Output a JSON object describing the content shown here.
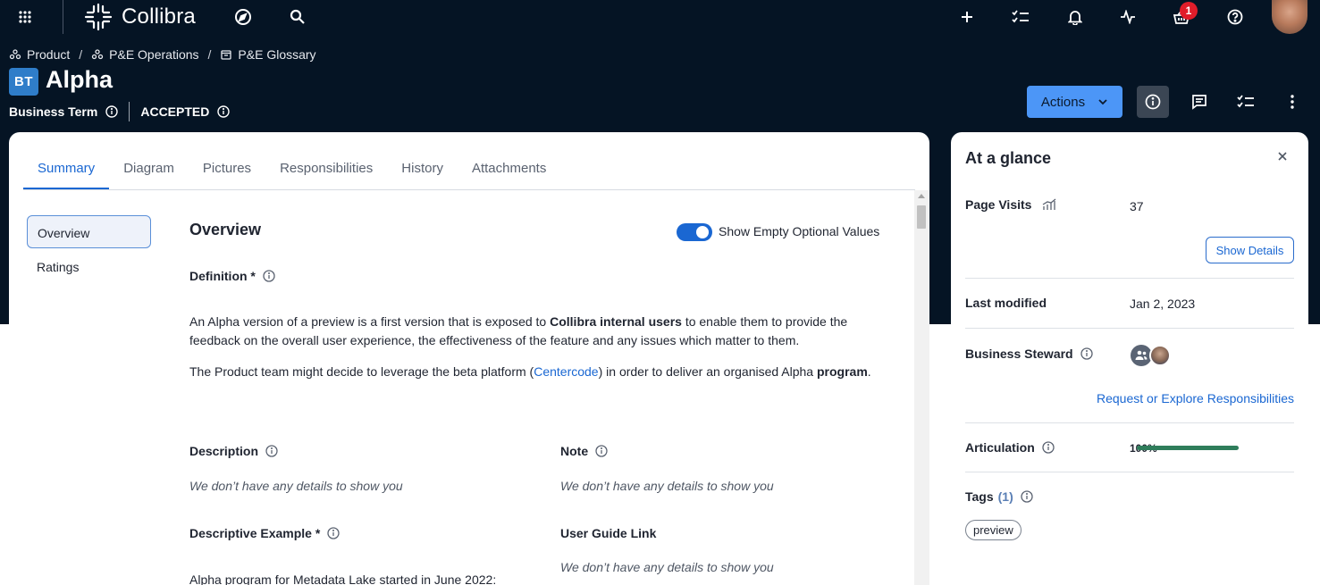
{
  "topbar": {
    "brand": "Collibra",
    "notification_count": "1"
  },
  "breadcrumb": [
    {
      "label": "Product",
      "icon": "community-icon"
    },
    {
      "label": "P&E Operations",
      "icon": "community-icon"
    },
    {
      "label": "P&E Glossary",
      "icon": "glossary-icon"
    }
  ],
  "asset": {
    "type_badge": "BT",
    "title": "Alpha",
    "type_label": "Business Term",
    "status": "ACCEPTED"
  },
  "header_actions": {
    "actions_label": "Actions"
  },
  "tabs": [
    "Summary",
    "Diagram",
    "Pictures",
    "Responsibilities",
    "History",
    "Attachments"
  ],
  "side_nav": [
    "Overview",
    "Ratings"
  ],
  "overview": {
    "title": "Overview",
    "toggle_label": "Show Empty Optional Values",
    "toggle_on": true,
    "definition_label": "Definition *",
    "definition_p1_a": "An Alpha version of a preview is a first version that is exposed to ",
    "definition_p1_bold": "Collibra internal users",
    "definition_p1_b": " to enable them to provide the feedback on the overall user experience, the effectiveness of the feature and any issues which matter to them.",
    "definition_p2_a": "The Product team might decide to leverage the beta platform (",
    "definition_p2_link": "Centercode",
    "definition_p2_b": ") in order to deliver an organised Alpha ",
    "definition_p2_bold": "program",
    "definition_p2_c": ".",
    "description_label": "Description",
    "description_value": "We don’t have any details to show you",
    "note_label": "Note",
    "note_value": "We don’t have any details to show you",
    "desc_example_label": "Descriptive Example *",
    "desc_example_value": "Alpha program for Metadata Lake started in June 2022:",
    "user_guide_label": "User Guide Link",
    "user_guide_value": "We don’t have any details to show you"
  },
  "glance": {
    "title": "At a glance",
    "page_visits_label": "Page Visits",
    "page_visits_value": "37",
    "show_details": "Show Details",
    "last_modified_label": "Last modified",
    "last_modified_value": "Jan 2, 2023",
    "steward_label": "Business Steward",
    "responsibilities_link": "Request or Explore Responsibilities",
    "articulation_label": "Articulation",
    "articulation_value": "100%",
    "articulation_fraction": 1.0,
    "tags_label": "Tags",
    "tags_count": "(1)",
    "tags": [
      "preview"
    ]
  },
  "colors": {
    "header_bg": "#051424",
    "primary": "#1a67d2",
    "actions_button": "#4c96f7",
    "progress": "#2f7d5b",
    "badge": "#e11d2a"
  }
}
